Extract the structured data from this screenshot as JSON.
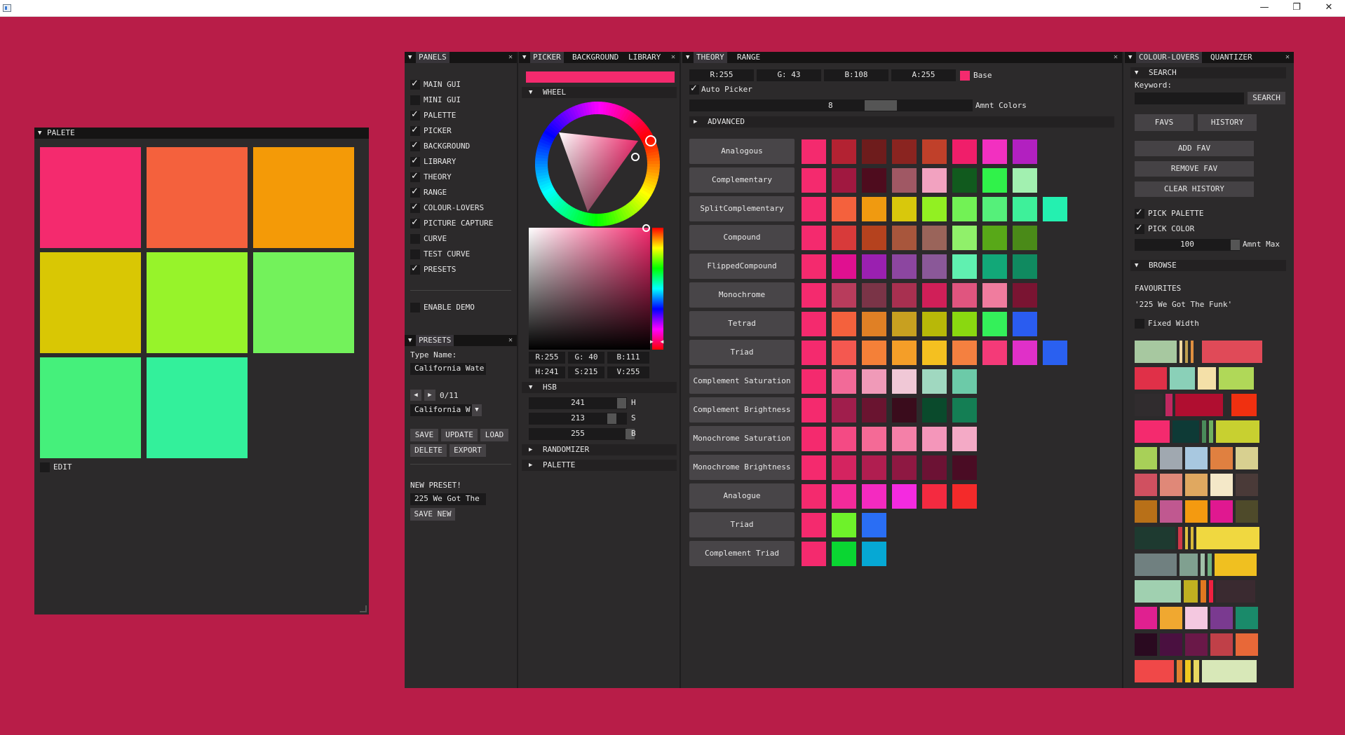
{
  "window": {
    "min_glyph": "—",
    "max_glyph": "❐",
    "close_glyph": "✕"
  },
  "palete": {
    "title": "PALETE",
    "swatches": [
      "#f42a6e",
      "#f4613d",
      "#f49a07",
      "#d9c704",
      "#97f32a",
      "#73f25b",
      "#45f07b",
      "#33f09b"
    ],
    "edit_label": "EDIT"
  },
  "panels": {
    "title": "PANELS",
    "items": [
      {
        "label": "MAIN GUI",
        "checked": true
      },
      {
        "label": "MINI GUI",
        "checked": false
      },
      {
        "label": "PALETTE",
        "checked": true
      },
      {
        "label": "PICKER",
        "checked": true
      },
      {
        "label": "BACKGROUND",
        "checked": true
      },
      {
        "label": "LIBRARY",
        "checked": true
      },
      {
        "label": "THEORY",
        "checked": true
      },
      {
        "label": "RANGE",
        "checked": true
      },
      {
        "label": "COLOUR-LOVERS",
        "checked": true
      },
      {
        "label": "PICTURE CAPTURE",
        "checked": true
      },
      {
        "label": "CURVE",
        "checked": false
      },
      {
        "label": "TEST CURVE",
        "checked": false
      },
      {
        "label": "PRESETS",
        "checked": true
      }
    ],
    "enable_demo": "ENABLE DEMO"
  },
  "presets": {
    "title": "PRESETS",
    "type_name_label": "Type Name:",
    "type_name_value": "California Wate",
    "counter": "0/11",
    "selected": "California W",
    "buttons": [
      "SAVE",
      "UPDATE",
      "LOAD",
      "DELETE",
      "EXPORT"
    ],
    "new_preset_label": "NEW PRESET!",
    "new_preset_value": "225 We Got The",
    "save_new": "SAVE NEW"
  },
  "picker": {
    "tabs": [
      "PICKER",
      "BACKGROUND",
      "LIBRARY"
    ],
    "current_color": "#f42a6e",
    "wheel_label": "WHEEL",
    "values": {
      "r": "R:255",
      "g": "G: 40",
      "b": "B:111",
      "h": "H:241",
      "s": "S:215",
      "v": "V:255"
    },
    "hsb_label": "HSB",
    "hsb": [
      {
        "value": "241",
        "label": "H"
      },
      {
        "value": "213",
        "label": "S"
      },
      {
        "value": "255",
        "label": "B"
      }
    ],
    "randomizer_label": "RANDOMIZER",
    "palette_label": "PALETTE"
  },
  "theory": {
    "tabs": [
      "THEORY",
      "RANGE"
    ],
    "rgba": [
      "R:255",
      "G: 43",
      "B:108",
      "A:255"
    ],
    "base_label": "Base",
    "base_color": "#f42a6e",
    "auto_picker": "Auto Picker",
    "amount": "8",
    "amount_label": "Amnt Colors",
    "advanced": "ADVANCED",
    "rows": [
      {
        "label": "Analogous",
        "colors": [
          "#f42a6e",
          "#b32232",
          "#6e1c1c",
          "#8a2420",
          "#c0402a",
          "#f01e6a",
          "#f230c0",
          "#b220c0"
        ]
      },
      {
        "label": "Complementary",
        "colors": [
          "#f42a6e",
          "#a01840",
          "#4e0c1e",
          "#a05864",
          "#f2a2c0",
          "#115a1e",
          "#30f24a",
          "#a2f0b0"
        ]
      },
      {
        "label": "SplitComplementary",
        "colors": [
          "#f42a6e",
          "#f4613d",
          "#f09a10",
          "#d8c80c",
          "#92f022",
          "#72f255",
          "#55f07a",
          "#3ef09a",
          "#24f0b0"
        ]
      },
      {
        "label": "Compound",
        "colors": [
          "#f42a6e",
          "#d83a3a",
          "#b5421e",
          "#a8563c",
          "#9a645a",
          "#90f06a",
          "#58a818",
          "#4a8a18"
        ]
      },
      {
        "label": "FlippedCompound",
        "colors": [
          "#f42a6e",
          "#e01090",
          "#9a20b0",
          "#8c46a0",
          "#8a5898",
          "#60f0b0",
          "#12a878",
          "#108a60"
        ]
      },
      {
        "label": "Monochrome",
        "colors": [
          "#f42a6e",
          "#b83c5c",
          "#7a3447",
          "#a83050",
          "#d01f58",
          "#e0557f",
          "#f07c9e",
          "#7a1432"
        ]
      },
      {
        "label": "Tetrad",
        "colors": [
          "#f42a6e",
          "#f4613d",
          "#e08025",
          "#c8a020",
          "#b8b808",
          "#8ad810",
          "#34f05a",
          "#2a5cf0"
        ]
      },
      {
        "label": "Triad",
        "colors": [
          "#f42a6e",
          "#f45850",
          "#f48038",
          "#f49e28",
          "#f4c020",
          "#f48040",
          "#f43a78",
          "#e030c8",
          "#2a60f0"
        ]
      },
      {
        "label": "Complement Saturation",
        "colors": [
          "#f42a6e",
          "#f26a98",
          "#f09ab8",
          "#f0c8d6",
          "#a0d8c0",
          "#6ccaa8"
        ]
      },
      {
        "label": "Complement Brightness",
        "colors": [
          "#f42a6e",
          "#a01e4c",
          "#6a1430",
          "#3a0c1c",
          "#0a4a2c",
          "#147e54"
        ]
      },
      {
        "label": "Monochrome Saturation",
        "colors": [
          "#f42a6e",
          "#f44a84",
          "#f46a96",
          "#f480a8",
          "#f496ba",
          "#f4aac6"
        ]
      },
      {
        "label": "Monochrome Brightness",
        "colors": [
          "#f42a6e",
          "#d42460",
          "#b01e50",
          "#8e1842",
          "#6c1234",
          "#4a0c24"
        ]
      },
      {
        "label": "Analogue",
        "colors": [
          "#f42a6e",
          "#f42a9a",
          "#f42ac0",
          "#f42ae0",
          "#f42a40",
          "#f42a2a"
        ]
      },
      {
        "label": "Triad",
        "colors": [
          "#f42a6e",
          "#6ef22a",
          "#2a6ef4"
        ]
      },
      {
        "label": "Complement Triad",
        "colors": [
          "#f42a6e",
          "#0ad632",
          "#06a8d4"
        ]
      }
    ]
  },
  "colourlovers": {
    "tabs": [
      "COLOUR-LOVERS",
      "QUANTIZER"
    ],
    "search_section": "SEARCH",
    "keyword_label": "Keyword:",
    "search_btn": "SEARCH",
    "favs": "FAVS",
    "history": "HISTORY",
    "add_fav": "ADD FAV",
    "remove_fav": "REMOVE FAV",
    "clear_history": "CLEAR HISTORY",
    "pick_palette": "PICK PALETTE",
    "pick_color": "PICK COLOR",
    "amnt_max_value": "100",
    "amnt_max_label": "Amnt Max",
    "browse_section": "BROWSE",
    "favourites_label": "FAVOURITES",
    "favourite_name": "'225 We Got The Funk'",
    "fixed_width": "Fixed Width",
    "palette_rows": [
      [
        {
          "c": "#a7c8a0",
          "w": 60
        },
        {
          "c": "#f0d8a0",
          "w": 4
        },
        {
          "c": "#c0a050",
          "w": 4
        },
        {
          "c": "#e09040",
          "w": 4
        },
        {
          "c": "#2c2a2b",
          "w": 4
        },
        {
          "c": "#e04a58",
          "w": 86
        }
      ],
      [
        {
          "c": "#e03048",
          "w": 46
        },
        {
          "c": "#8ad0b8",
          "w": 36
        },
        {
          "c": "#f4e0a8",
          "w": 26
        },
        {
          "c": "#b0d858",
          "w": 50
        },
        {
          "c": "#2c2a2b",
          "w": 4
        }
      ],
      [
        {
          "c": "#302c2e",
          "w": 40
        },
        {
          "c": "#c02860",
          "w": 10
        },
        {
          "c": "#b00e30",
          "w": 68
        },
        {
          "c": "#2c2a2b",
          "w": 4
        },
        {
          "c": "#f03010",
          "w": 36
        }
      ],
      [
        {
          "c": "#f42a6e",
          "w": 50
        },
        {
          "c": "#0e3a36",
          "w": 38
        },
        {
          "c": "#4a8a5a",
          "w": 6
        },
        {
          "c": "#70b060",
          "w": 6
        },
        {
          "c": "#c8d030",
          "w": 62
        }
      ],
      [
        {
          "c": "#a8d058",
          "w": 32
        },
        {
          "c": "#a0a8b0",
          "w": 32
        },
        {
          "c": "#a8c8e0",
          "w": 32
        },
        {
          "c": "#e08040",
          "w": 32
        },
        {
          "c": "#d8d090",
          "w": 32
        }
      ],
      [
        {
          "c": "#d05060",
          "w": 32
        },
        {
          "c": "#e08878",
          "w": 32
        },
        {
          "c": "#e0a860",
          "w": 32
        },
        {
          "c": "#f4e8c8",
          "w": 32
        },
        {
          "c": "#4a3a38",
          "w": 32
        }
      ],
      [
        {
          "c": "#b87018",
          "w": 32
        },
        {
          "c": "#c05890",
          "w": 32
        },
        {
          "c": "#f49a10",
          "w": 32
        },
        {
          "c": "#e01890",
          "w": 32
        },
        {
          "c": "#4e4a2a",
          "w": 32
        }
      ],
      [
        {
          "c": "#1e3a30",
          "w": 58
        },
        {
          "c": "#d03848",
          "w": 6
        },
        {
          "c": "#e0c040",
          "w": 4
        },
        {
          "c": "#d8b838",
          "w": 4
        },
        {
          "c": "#f0d840",
          "w": 90
        }
      ],
      [
        {
          "c": "#708080",
          "w": 60
        },
        {
          "c": "#80a090",
          "w": 26
        },
        {
          "c": "#a0c0a8",
          "w": 6
        },
        {
          "c": "#70b080",
          "w": 6
        },
        {
          "c": "#f0c020",
          "w": 60
        }
      ],
      [
        {
          "c": "#a0d0b0",
          "w": 66
        },
        {
          "c": "#c0b020",
          "w": 20
        },
        {
          "c": "#e07820",
          "w": 8
        },
        {
          "c": "#f02040",
          "w": 6
        },
        {
          "c": "#3a2a30",
          "w": 56
        }
      ],
      [
        {
          "c": "#e02090",
          "w": 32
        },
        {
          "c": "#f0a830",
          "w": 32
        },
        {
          "c": "#f4c8e0",
          "w": 32
        },
        {
          "c": "#7a3a90",
          "w": 32
        },
        {
          "c": "#1a8a6a",
          "w": 32
        }
      ],
      [
        {
          "c": "#2a0a20",
          "w": 32
        },
        {
          "c": "#4a1040",
          "w": 32
        },
        {
          "c": "#6a1848",
          "w": 32
        },
        {
          "c": "#c04048",
          "w": 32
        },
        {
          "c": "#e86838",
          "w": 32
        }
      ],
      [
        {
          "c": "#f04848",
          "w": 56
        },
        {
          "c": "#e08030",
          "w": 8
        },
        {
          "c": "#f0c820",
          "w": 8
        },
        {
          "c": "#e8d860",
          "w": 8
        },
        {
          "c": "#d8e8b8",
          "w": 78
        }
      ]
    ]
  }
}
